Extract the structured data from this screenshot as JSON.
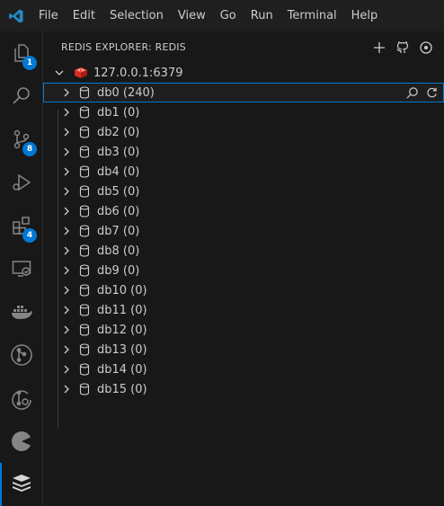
{
  "menu": [
    "File",
    "Edit",
    "Selection",
    "View",
    "Go",
    "Run",
    "Terminal",
    "Help"
  ],
  "activity": [
    {
      "name": "explorer-icon",
      "badge": "1"
    },
    {
      "name": "search-icon",
      "badge": ""
    },
    {
      "name": "source-control-icon",
      "badge": "8"
    },
    {
      "name": "run-debug-icon",
      "badge": ""
    },
    {
      "name": "extensions-icon",
      "badge": "4"
    },
    {
      "name": "remote-explorer-icon",
      "badge": ""
    },
    {
      "name": "docker-icon",
      "badge": ""
    },
    {
      "name": "git-graph-icon",
      "badge": ""
    },
    {
      "name": "gitlens-icon",
      "badge": ""
    },
    {
      "name": "pie-icon",
      "badge": ""
    },
    {
      "name": "redis-icon",
      "badge": ""
    }
  ],
  "sidebar": {
    "title": "REDIS EXPLORER: REDIS",
    "connection": "127.0.0.1:6379",
    "databases": [
      "db0 (240)",
      "db1 (0)",
      "db2 (0)",
      "db3 (0)",
      "db4 (0)",
      "db5 (0)",
      "db6 (0)",
      "db7 (0)",
      "db8 (0)",
      "db9 (0)",
      "db10 (0)",
      "db11 (0)",
      "db12 (0)",
      "db13 (0)",
      "db14 (0)",
      "db15 (0)"
    ]
  },
  "colors": {
    "accent": "#0078d4",
    "redis": "#d82c20",
    "background": "#181818"
  }
}
